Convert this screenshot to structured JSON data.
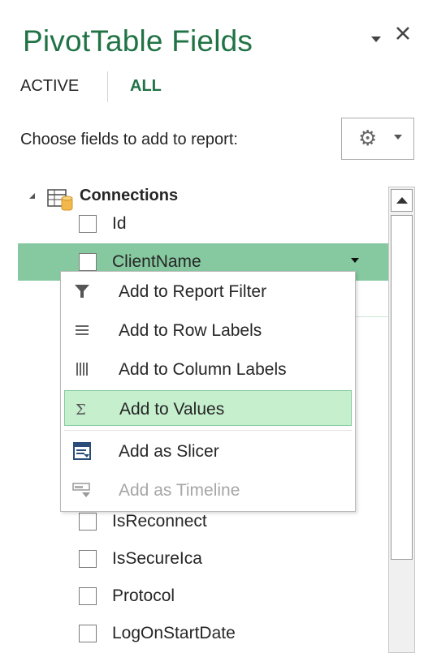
{
  "header": {
    "title": "PivotTable Fields",
    "tabs": [
      {
        "label": "ACTIVE"
      },
      {
        "label": "ALL"
      }
    ],
    "choose_label": "Choose fields to add to report:"
  },
  "tree": {
    "root_label": "Connections",
    "fields": [
      {
        "label": "Id",
        "checked": false
      },
      {
        "label": "ClientName",
        "checked": false,
        "highlighted": true
      },
      {
        "label": "IsReconnect",
        "checked": false
      },
      {
        "label": "IsSecureIca",
        "checked": false
      },
      {
        "label": "Protocol",
        "checked": false
      },
      {
        "label": "LogOnStartDate",
        "checked": false
      }
    ]
  },
  "context_menu": {
    "items": [
      {
        "label": "Add to Report Filter",
        "icon": "filter-icon",
        "enabled": true
      },
      {
        "label": "Add to Row Labels",
        "icon": "row-labels-icon",
        "enabled": true
      },
      {
        "label": "Add to Column Labels",
        "icon": "column-labels-icon",
        "enabled": true
      },
      {
        "label": "Add to Values",
        "icon": "sigma-icon",
        "enabled": true,
        "highlighted": true
      },
      {
        "label": "Add as Slicer",
        "icon": "slicer-icon",
        "enabled": true
      },
      {
        "label": "Add as Timeline",
        "icon": "timeline-icon",
        "enabled": false
      }
    ]
  },
  "colors": {
    "accent": "#217346",
    "row_highlight": "#86c9a0",
    "menu_highlight": "#c6efce"
  }
}
